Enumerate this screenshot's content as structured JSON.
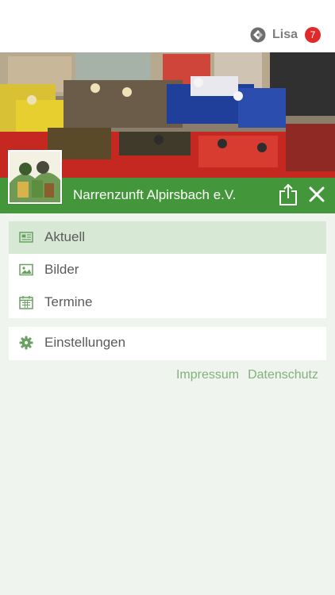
{
  "user": {
    "name": "Lisa",
    "notification_count": "7",
    "logo_icon": "app-logo-icon"
  },
  "club": {
    "name": "Narrenzunft Alpirsbach e.V.",
    "share_icon": "share-icon",
    "close_icon": "close-icon"
  },
  "menu": {
    "items": [
      {
        "label": "Aktuell",
        "icon": "newspaper-icon",
        "active": true
      },
      {
        "label": "Bilder",
        "icon": "image-icon",
        "active": false
      },
      {
        "label": "Termine",
        "icon": "calendar-icon",
        "active": false
      }
    ],
    "settings": {
      "label": "Einstellungen",
      "icon": "gear-icon"
    }
  },
  "footer": {
    "impressum": "Impressum",
    "datenschutz": "Datenschutz"
  },
  "colors": {
    "primary_green": "#43963a",
    "active_item": "#d7e8d4",
    "background": "#eff5ee",
    "badge_red": "#e02a2a",
    "link_green": "#84b07d"
  }
}
